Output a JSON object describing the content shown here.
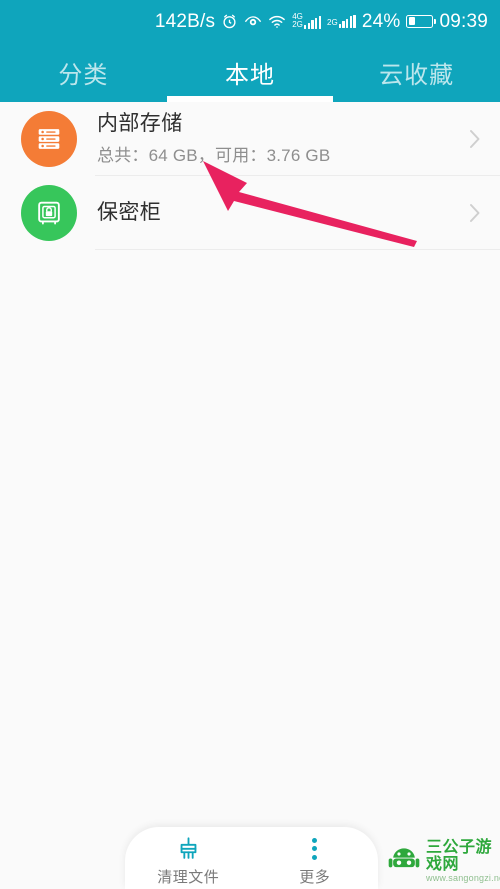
{
  "statusbar": {
    "network_speed": "142B/s",
    "battery_percent": "24%",
    "clock": "09:39",
    "signal1_label_top": "4G",
    "signal1_label_bottom": "2G",
    "signal2_label": "2G",
    "icons": [
      "alarm-icon",
      "eye-icon",
      "wifi-icon",
      "signal-icon",
      "signal-icon",
      "battery-icon"
    ],
    "bar_color": "#0FA5BC"
  },
  "tabs": [
    {
      "label": "分类",
      "active": false
    },
    {
      "label": "本地",
      "active": true
    },
    {
      "label": "云收藏",
      "active": false
    }
  ],
  "list": {
    "items": [
      {
        "title": "内部存储",
        "subtitle": "总共：64 GB，可用：3.76 GB",
        "icon": "storage-icon",
        "icon_color": "#F47C36",
        "chevron": "chevron-right-icon"
      },
      {
        "title": "保密柜",
        "subtitle": "",
        "icon": "safe-lock-icon",
        "icon_color": "#37C65B",
        "chevron": "chevron-right-icon"
      }
    ]
  },
  "bottombar": {
    "items": [
      {
        "label": "清理文件",
        "icon": "broom-icon"
      },
      {
        "label": "更多",
        "icon": "more-vertical-icon"
      }
    ],
    "accent": "#0FA5BC"
  },
  "annotation": {
    "arrow": "pink-arrow-annotation",
    "color": "#E8225F"
  },
  "watermark": {
    "title": "三公子游戏网",
    "url": "www.sangongzi.net",
    "logo": "android-robot-icon",
    "color": "#2EA83C"
  }
}
